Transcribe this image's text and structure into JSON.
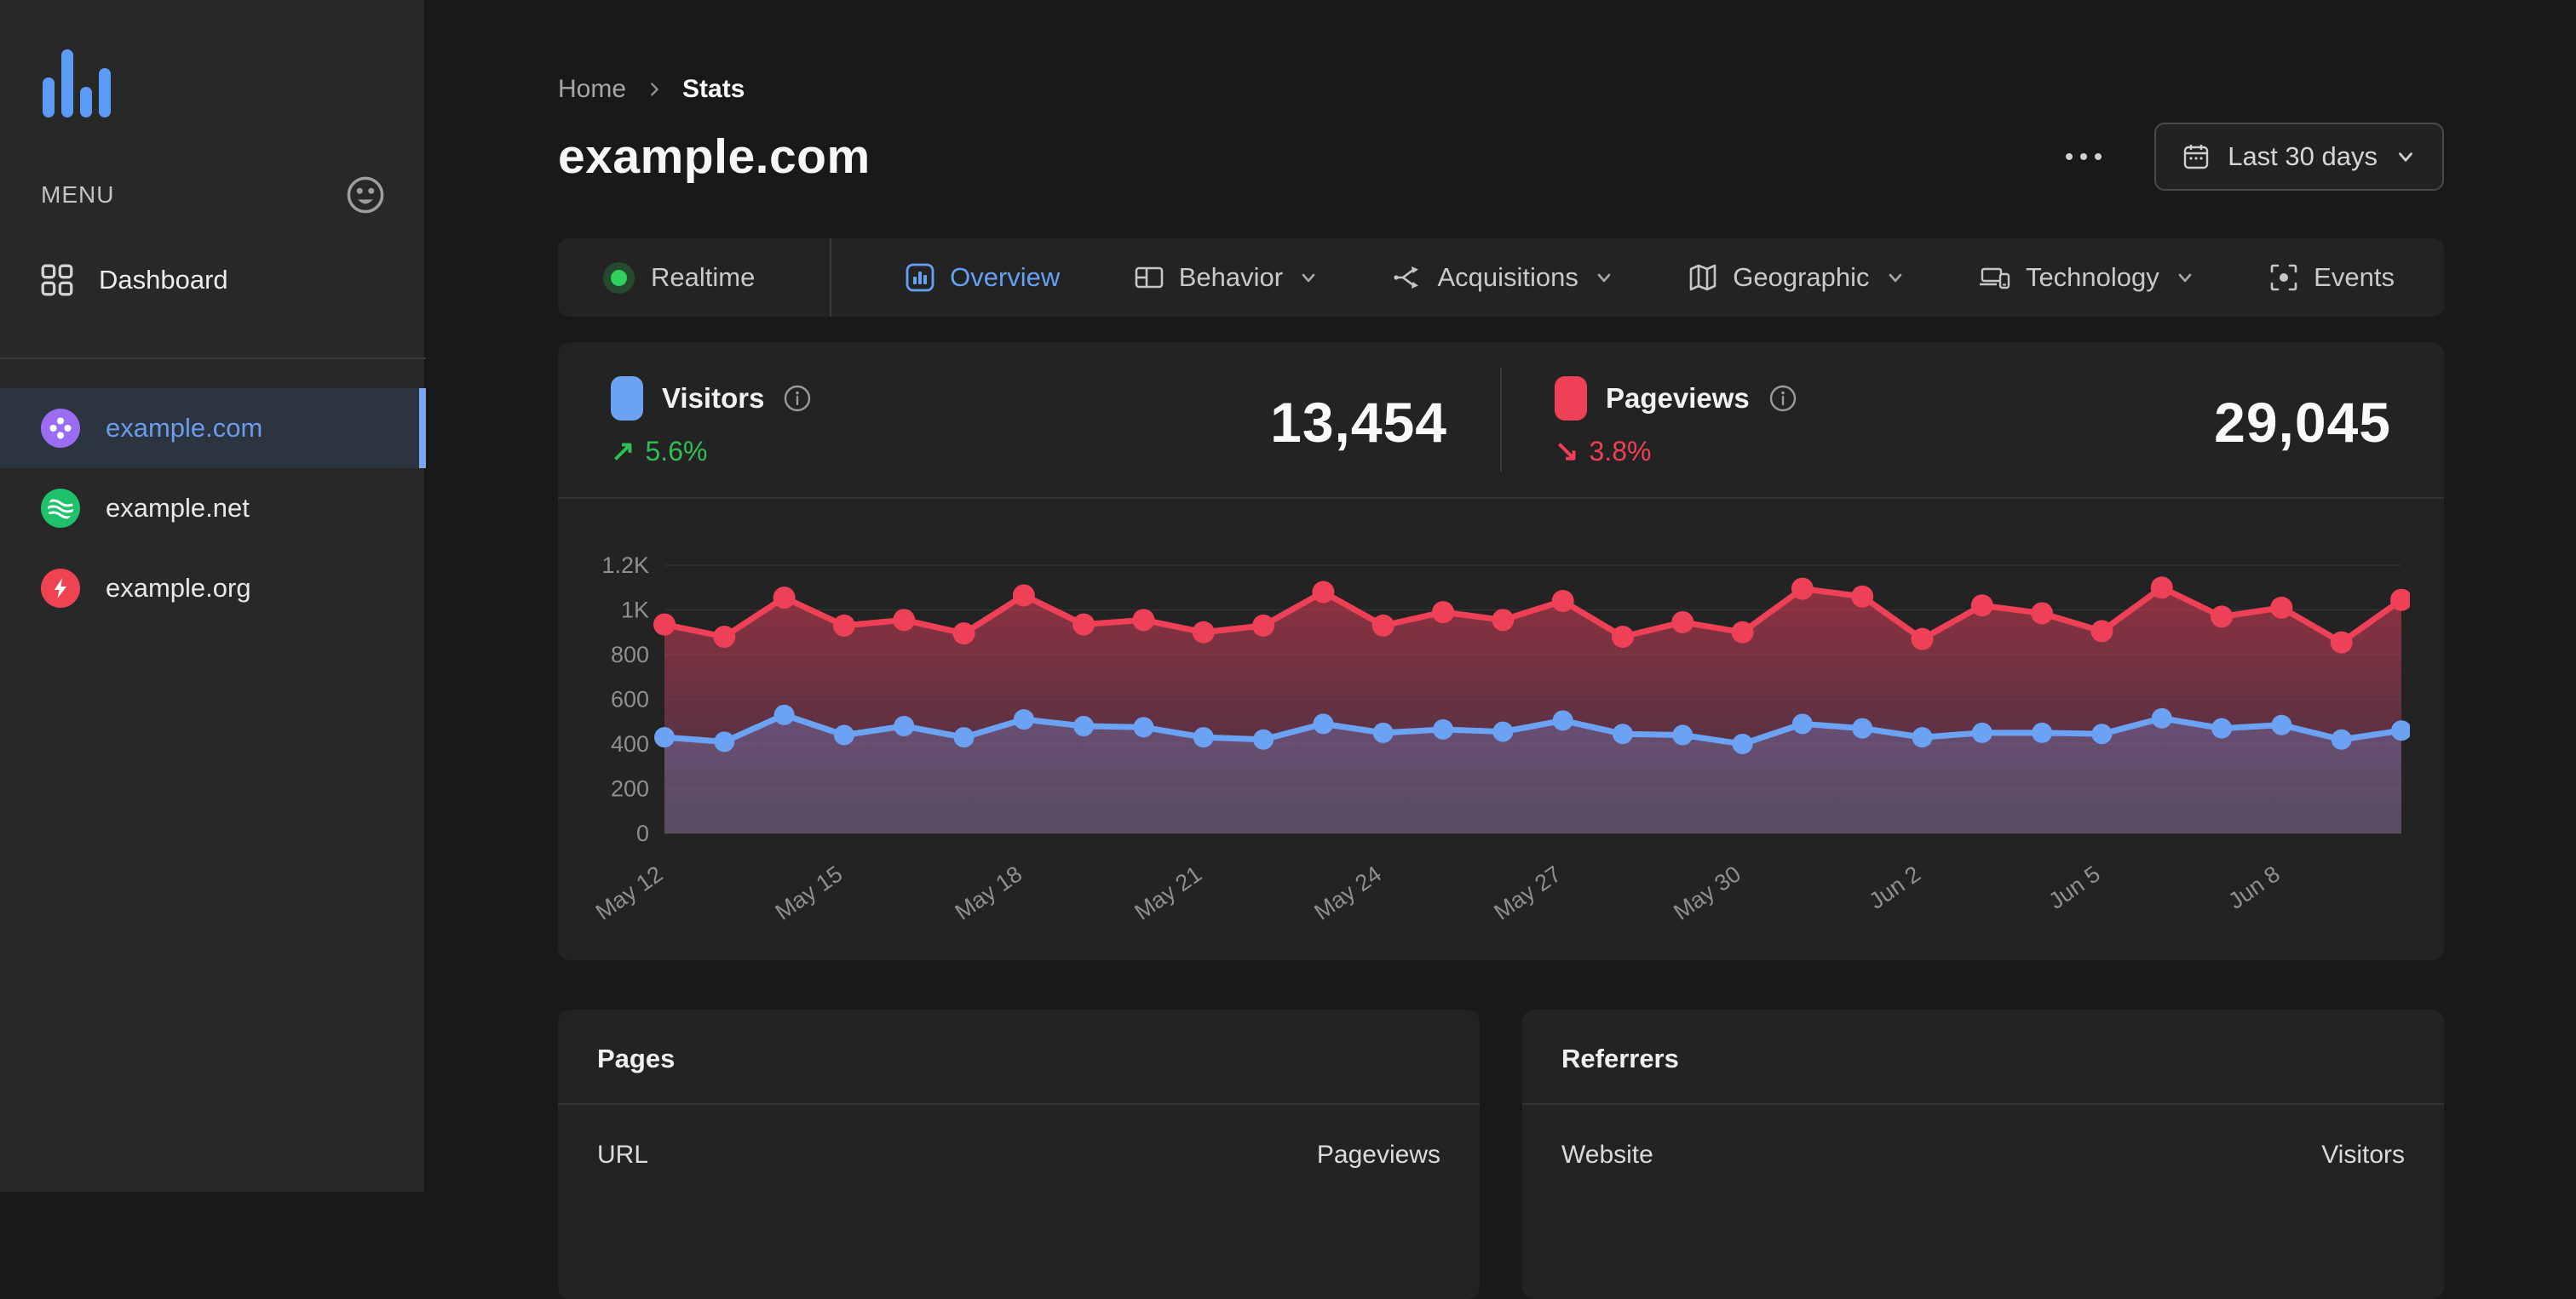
{
  "sidebar": {
    "menu_label": "MENU",
    "nav": [
      {
        "label": "Dashboard"
      }
    ],
    "sites": [
      {
        "label": "example.com",
        "active": true,
        "color": "#9b6df5"
      },
      {
        "label": "example.net",
        "active": false,
        "color": "#1fc26b"
      },
      {
        "label": "example.org",
        "active": false,
        "color": "#ef4352"
      }
    ]
  },
  "header": {
    "breadcrumb": {
      "home": "Home",
      "current": "Stats"
    },
    "title": "example.com",
    "date_range_label": "Last 30 days"
  },
  "tabs": {
    "items": [
      {
        "label": "Realtime",
        "active": false
      },
      {
        "label": "Overview",
        "active": true
      },
      {
        "label": "Behavior",
        "active": false,
        "dropdown": true
      },
      {
        "label": "Acquisitions",
        "active": false,
        "dropdown": true
      },
      {
        "label": "Geographic",
        "active": false,
        "dropdown": true
      },
      {
        "label": "Technology",
        "active": false,
        "dropdown": true
      },
      {
        "label": "Events",
        "active": false
      }
    ]
  },
  "overview": {
    "metrics": [
      {
        "label": "Visitors",
        "value": "13,454",
        "delta": "5.6%",
        "trend": "up",
        "arrow": "↗",
        "swatch_color": "#6ba2f4",
        "delta_color": "#2fbf55"
      },
      {
        "label": "Pageviews",
        "value": "29,045",
        "delta": "3.8%",
        "trend": "down",
        "arrow": "↘",
        "swatch_color": "#ee4056",
        "delta_color": "#ef4056"
      }
    ]
  },
  "chart_data": {
    "type": "line",
    "title": "Visitors and Pageviews over last 30 days",
    "x": [
      "May 12",
      "May 13",
      "May 14",
      "May 15",
      "May 16",
      "May 17",
      "May 18",
      "May 19",
      "May 20",
      "May 21",
      "May 22",
      "May 23",
      "May 24",
      "May 25",
      "May 26",
      "May 27",
      "May 28",
      "May 29",
      "May 30",
      "May 31",
      "Jun 1",
      "Jun 2",
      "Jun 3",
      "Jun 4",
      "Jun 5",
      "Jun 6",
      "Jun 7",
      "Jun 8",
      "Jun 9",
      "Jun 10"
    ],
    "x_label_every": 3,
    "series": [
      {
        "name": "Pageviews",
        "color": "#ee4056",
        "values": [
          935,
          880,
          1055,
          930,
          955,
          895,
          1065,
          935,
          955,
          900,
          930,
          1080,
          930,
          990,
          955,
          1040,
          880,
          945,
          900,
          1095,
          1060,
          870,
          1020,
          985,
          905,
          1100,
          970,
          1010,
          855,
          1045
        ]
      },
      {
        "name": "Visitors",
        "color": "#6ba2f4",
        "values": [
          430,
          410,
          530,
          440,
          480,
          430,
          510,
          480,
          475,
          430,
          420,
          490,
          450,
          465,
          455,
          505,
          445,
          440,
          400,
          490,
          470,
          430,
          450,
          450,
          445,
          515,
          470,
          485,
          420,
          460
        ]
      }
    ],
    "ylim": [
      0,
      1200
    ],
    "y_tick_values": [
      0,
      200,
      400,
      600,
      800,
      1000,
      1200
    ],
    "y_ticks": [
      "0",
      "200",
      "400",
      "600",
      "800",
      "1K",
      "1.2K"
    ],
    "grid": true,
    "legend_position": "top"
  },
  "tables": [
    {
      "title": "Pages",
      "columns": [
        "URL",
        "Pageviews"
      ]
    },
    {
      "title": "Referrers",
      "columns": [
        "Website",
        "Visitors"
      ]
    }
  ]
}
